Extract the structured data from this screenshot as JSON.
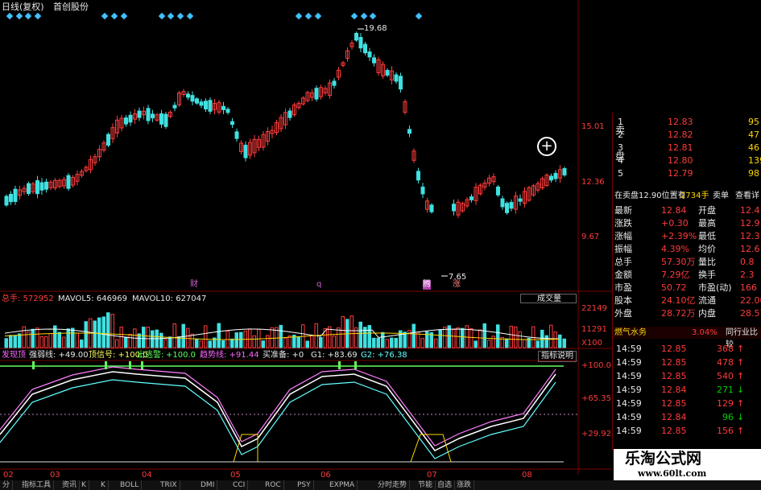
{
  "header": {
    "period": "日线(复权)",
    "stock_name": "首创股份"
  },
  "price_axis": {
    "labels": [
      "15.01",
      "12.36",
      "9.67"
    ],
    "high_marker": "19.68",
    "low_marker": "7.65"
  },
  "event_markers": [
    "财",
    "q",
    "腾",
    "涨"
  ],
  "volume_panel": {
    "label_total": "总手: 572952",
    "label_ma5": "MAVOL5: 646969",
    "label_ma10": "MAVOL10: 627047",
    "dropdown": "成交量",
    "axis": [
      "22149",
      "11291",
      "X100"
    ]
  },
  "indicator_panel": {
    "label_items": [
      "发现顶",
      "强弱线: +49.00",
      "顶信号: +100.0",
      "出逃警:",
      "+100.0",
      "趋势线: +91.44",
      "买准备: +0",
      "G1: +83.69",
      "G2: +76.38"
    ],
    "help_button": "指标说明",
    "axis": [
      "+100.0",
      "+65.35",
      "+29.92"
    ]
  },
  "date_axis": [
    "02",
    "03",
    "04",
    "05",
    "06",
    "07",
    "08"
  ],
  "order_book": {
    "sell_label": [
      "卖",
      "盘"
    ],
    "rows": [
      {
        "n": "1",
        "price": "12.83",
        "vol": "95"
      },
      {
        "n": "2",
        "price": "12.82",
        "vol": "47"
      },
      {
        "n": "3",
        "price": "12.81",
        "vol": "46"
      },
      {
        "n": "4",
        "price": "12.80",
        "vol": "139"
      },
      {
        "n": "5",
        "price": "12.79",
        "vol": "98"
      }
    ],
    "notice": "在卖盘12.90位置有",
    "notice_vol": "2734手",
    "notice_btn1": "卖单",
    "notice_btn2": "查看详"
  },
  "quote": [
    {
      "a": "最新",
      "av": "12.84",
      "b": "开盘",
      "bv": "12.4"
    },
    {
      "a": "涨跌",
      "av": "+0.30",
      "b": "最高",
      "bv": "12.9"
    },
    {
      "a": "涨幅",
      "av": "+2.39%",
      "b": "最低",
      "bv": "12.3"
    },
    {
      "a": "振幅",
      "av": "4.39%",
      "b": "均价",
      "bv": "12.6"
    },
    {
      "a": "总手",
      "av": "57.30万",
      "b": "量比",
      "bv": "0.8"
    },
    {
      "a": "金额",
      "av": "7.29亿",
      "b": "换手",
      "bv": "2.3"
    },
    {
      "a": "市盈",
      "av": "50.72",
      "b": "市盈(动)",
      "bv": "166"
    },
    {
      "a": "股本",
      "av": "24.10亿",
      "b": "流通",
      "bv": "22.00"
    },
    {
      "a": "外盘",
      "av": "28.72万",
      "b": "内盘",
      "bv": "28.57"
    }
  ],
  "sector": {
    "name": "燃气水务",
    "change": "3.04%",
    "compare": "同行业比较"
  },
  "ticks": [
    {
      "time": "14:59",
      "price": "12.85",
      "vol": "368",
      "dir": "up"
    },
    {
      "time": "14:59",
      "price": "12.85",
      "vol": "478",
      "dir": "up"
    },
    {
      "time": "14:59",
      "price": "12.85",
      "vol": "540",
      "dir": "up"
    },
    {
      "time": "14:59",
      "price": "12.84",
      "vol": "271",
      "dir": "down"
    },
    {
      "time": "14:59",
      "price": "12.85",
      "vol": "129",
      "dir": "up"
    },
    {
      "time": "14:59",
      "price": "12.84",
      "vol": "96",
      "dir": "down"
    },
    {
      "time": "14:59",
      "price": "12.85",
      "vol": "156",
      "dir": "up"
    }
  ],
  "watermark": {
    "title": "乐淘公式网",
    "url": "www.60lt.com"
  },
  "bottom_tabs": [
    "分",
    "指标工具",
    "资讯",
    "K",
    "K",
    "BOLL",
    "TRIX",
    "DMI",
    "CCI",
    "ROC",
    "PSY",
    "EXPMA",
    "分时走势",
    "节能",
    "自选",
    "涨跌"
  ],
  "colors": {
    "up": "#ff3b3b",
    "down": "#40e0e0",
    "bg": "#000000",
    "grid": "#7a0000"
  }
}
